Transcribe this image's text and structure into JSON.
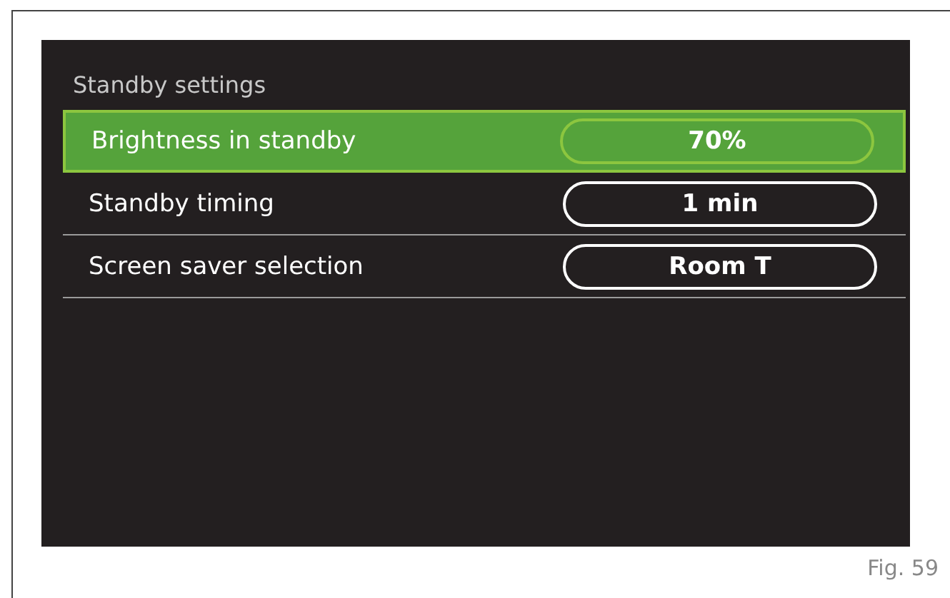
{
  "screen": {
    "title": "Standby settings",
    "rows": [
      {
        "label": "Brightness in standby",
        "value": "70%",
        "selected": true
      },
      {
        "label": "Standby timing",
        "value": "1 min",
        "selected": false
      },
      {
        "label": "Screen saver selection",
        "value": "Room T",
        "selected": false
      }
    ]
  },
  "caption": "Fig. 59"
}
